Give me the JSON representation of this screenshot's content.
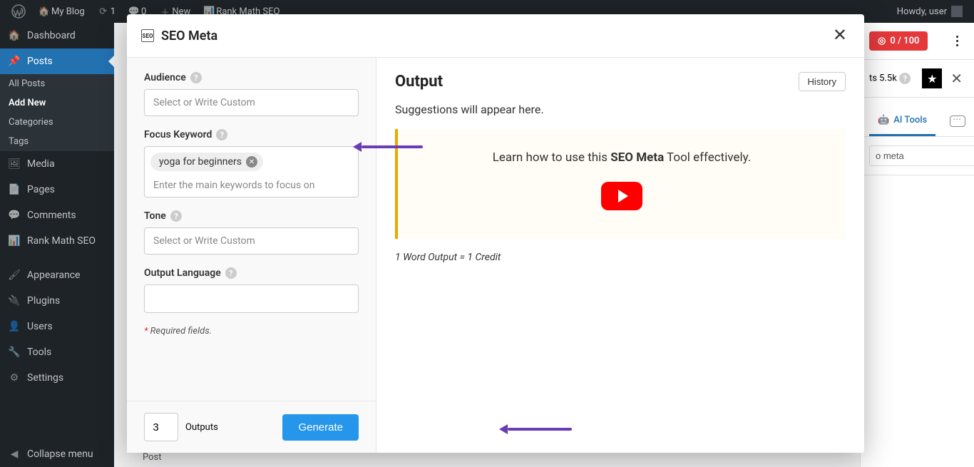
{
  "adminbar": {
    "site_name": "My Blog",
    "updates_count": "1",
    "comments_count": "0",
    "new_label": "New",
    "rank_math": "Rank Math SEO",
    "greeting": "Howdy, user"
  },
  "sidebar": {
    "items": [
      {
        "label": "Dashboard"
      },
      {
        "label": "Posts"
      },
      {
        "label": "Media"
      },
      {
        "label": "Pages"
      },
      {
        "label": "Comments"
      },
      {
        "label": "Rank Math SEO"
      },
      {
        "label": "Appearance"
      },
      {
        "label": "Plugins"
      },
      {
        "label": "Users"
      },
      {
        "label": "Tools"
      },
      {
        "label": "Settings"
      }
    ],
    "posts_submenu": [
      {
        "label": "All Posts"
      },
      {
        "label": "Add New"
      },
      {
        "label": "Categories"
      },
      {
        "label": "Tags"
      }
    ],
    "collapse": "Collapse menu"
  },
  "rightpanel": {
    "score": "0 / 100",
    "credits": "ts 5.5k",
    "ai_tools": "AI Tools",
    "search_value": "o meta"
  },
  "modal": {
    "title": "SEO Meta",
    "left": {
      "audience_label": "Audience",
      "audience_ph": "Select or Write Custom",
      "focus_label": "Focus Keyword",
      "focus_chip": "yoga for beginners",
      "focus_ph": "Enter the main keywords to focus on",
      "tone_label": "Tone",
      "tone_ph": "Select or Write Custom",
      "lang_label": "Output Language",
      "required": "Required fields.",
      "outputs_value": "3",
      "outputs_label": "Outputs",
      "generate": "Generate"
    },
    "right": {
      "output_title": "Output",
      "history": "History",
      "suggest": "Suggestions will appear here.",
      "learn_pre": "Learn how to use this ",
      "learn_bold": "SEO Meta",
      "learn_post": " Tool effectively.",
      "credit_note": "1 Word Output = 1 Credit"
    }
  },
  "posttab": "Post"
}
